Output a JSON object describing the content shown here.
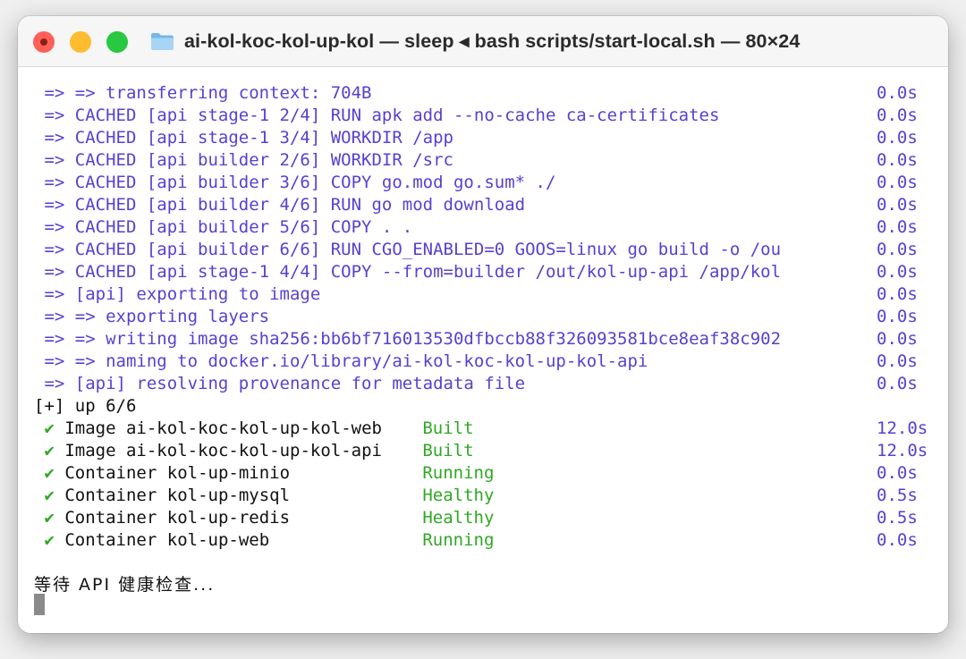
{
  "window": {
    "title": "ai-kol-koc-kol-up-kol — sleep ◂ bash scripts/start-local.sh — 80×24",
    "folder_icon": "folder-icon",
    "colors": {
      "close": "#ff5f57",
      "minimize": "#febc2e",
      "zoom": "#28c840",
      "build_text": "#5a3fd0",
      "success_text": "#2fa824"
    }
  },
  "terminal": {
    "build_lines": [
      {
        "text": " => => transferring context: 704B",
        "time": "0.0s"
      },
      {
        "text": " => CACHED [api stage-1 2/4] RUN apk add --no-cache ca-certificates",
        "time": "0.0s"
      },
      {
        "text": " => CACHED [api stage-1 3/4] WORKDIR /app",
        "time": "0.0s"
      },
      {
        "text": " => CACHED [api builder 2/6] WORKDIR /src",
        "time": "0.0s"
      },
      {
        "text": " => CACHED [api builder 3/6] COPY go.mod go.sum* ./",
        "time": "0.0s"
      },
      {
        "text": " => CACHED [api builder 4/6] RUN go mod download",
        "time": "0.0s"
      },
      {
        "text": " => CACHED [api builder 5/6] COPY . .",
        "time": "0.0s"
      },
      {
        "text": " => CACHED [api builder 6/6] RUN CGO_ENABLED=0 GOOS=linux go build -o /ou",
        "time": "0.0s"
      },
      {
        "text": " => CACHED [api stage-1 4/4] COPY --from=builder /out/kol-up-api /app/kol",
        "time": "0.0s"
      },
      {
        "text": " => [api] exporting to image",
        "time": "0.0s"
      },
      {
        "text": " => => exporting layers",
        "time": "0.0s"
      },
      {
        "text": " => => writing image sha256:bb6bf716013530dfbccb88f326093581bce8eaf38c902",
        "time": "0.0s"
      },
      {
        "text": " => => naming to docker.io/library/ai-kol-koc-kol-up-kol-api",
        "time": "0.0s"
      },
      {
        "text": " => [api] resolving provenance for metadata file",
        "time": "0.0s"
      }
    ],
    "summary_line": "[+] up 6/6",
    "services": [
      {
        "check": "✔",
        "name": "Image ai-kol-koc-kol-up-kol-web",
        "status": "Built",
        "time": "12.0s"
      },
      {
        "check": "✔",
        "name": "Image ai-kol-koc-kol-up-kol-api",
        "status": "Built",
        "time": "12.0s"
      },
      {
        "check": "✔",
        "name": "Container kol-up-minio",
        "status": "Running",
        "time": "0.0s"
      },
      {
        "check": "✔",
        "name": "Container kol-up-mysql",
        "status": "Healthy",
        "time": "0.5s"
      },
      {
        "check": "✔",
        "name": "Container kol-up-redis",
        "status": "Healthy",
        "time": "0.5s"
      },
      {
        "check": "✔",
        "name": "Container kol-up-web",
        "status": "Running",
        "time": "0.0s"
      }
    ],
    "waiting_message": "等待 API 健康检查..."
  }
}
